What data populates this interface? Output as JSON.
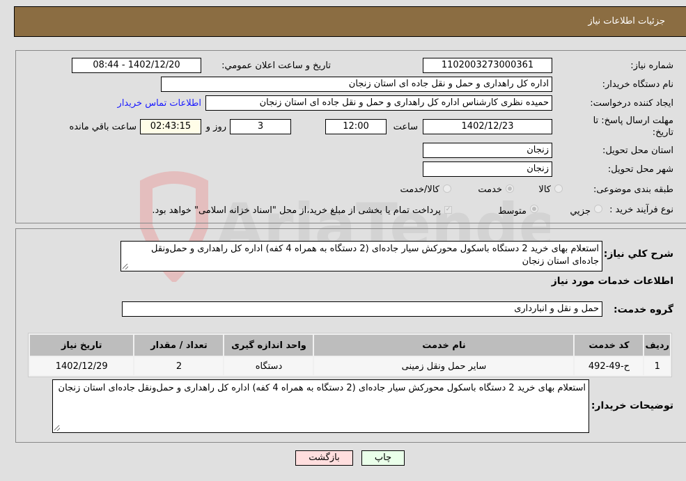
{
  "header": {
    "title": "جزئیات اطلاعات نیاز"
  },
  "form": {
    "need_number": {
      "label": "شماره نیاز:",
      "value": "1102003273000361"
    },
    "announce_datetime": {
      "label": "تاریخ و ساعت اعلان عمومي:",
      "value": "1402/12/20 - 08:44"
    },
    "buyer_org": {
      "label": "نام دستگاه خریدار:",
      "value": "اداره کل راهداری و حمل و نقل جاده ای استان زنجان"
    },
    "requester": {
      "label": "ایجاد کننده درخواست:",
      "value": "حمیده نظری کارشناس اداره کل راهداری و حمل و نقل جاده ای استان زنجان"
    },
    "buyer_contact_link": "اطلاعات تماس خریدار",
    "deadline": {
      "label": "مهلت ارسال پاسخ: تا تاریخ:",
      "date": "1402/12/23",
      "time_label": "ساعت",
      "time": "12:00",
      "days": "3",
      "days_label": "روز و",
      "remaining": "02:43:15",
      "remaining_label": "ساعت باقي مانده"
    },
    "delivery_province": {
      "label": "استان محل تحویل:",
      "value": "زنجان"
    },
    "delivery_city": {
      "label": "شهر محل تحویل:",
      "value": "زنجان"
    },
    "category": {
      "label": "طبقه بندی موضوعی:",
      "options": [
        "کالا",
        "خدمت",
        "کالا/خدمت"
      ],
      "selected": "خدمت"
    },
    "process_type": {
      "label": "نوع فرآیند خرید :",
      "options": [
        "جزيي",
        "متوسط"
      ],
      "selected": "متوسط",
      "treasury_note": "پرداخت تمام یا بخشی از مبلغ خرید،از محل \"اسناد خزانه اسلامی\" خواهد بود.",
      "treasury_checked": true
    }
  },
  "details": {
    "summary_label": "شرح کلي نیاز:",
    "summary": "استعلام بهای خرید 2 دستگاه باسکول محورکش سیار جاده‌ای (2 دستگاه به همراه 4 کفه) اداره کل راهداری و حمل‌ونقل جاده‌ای استان زنجان",
    "services_heading": "اطلاعات خدمات مورد نیاز",
    "service_group_label": "گروه خدمت:",
    "service_group": "حمل و نقل و انبارداری",
    "table": {
      "headers": [
        "ردیف",
        "کد خدمت",
        "نام خدمت",
        "واحد اندازه گیری",
        "تعداد / مقدار",
        "تاریخ نیاز"
      ],
      "rows": [
        [
          "1",
          "ح-49-492",
          "سایر حمل ونقل زمینی",
          "دستگاه",
          "2",
          "1402/12/29"
        ]
      ]
    },
    "buyer_notes_label": "توضیحات خریدار:",
    "buyer_notes": "استعلام بهای خرید 2 دستگاه باسکول محورکش سیار جاده‌ای (2 دستگاه به همراه 4 کفه) اداره کل راهداری و حمل‌ونقل جاده‌ای استان زنجان"
  },
  "buttons": {
    "print": "چاپ",
    "back": "بازگشت"
  },
  "watermark": "AriaTender.neT",
  "colors": {
    "header_bg": "#8b6d42",
    "link": "#1a1aff",
    "print_btn": "#eaffea",
    "back_btn": "#ffdede",
    "remaining_bg": "#fffde8"
  }
}
